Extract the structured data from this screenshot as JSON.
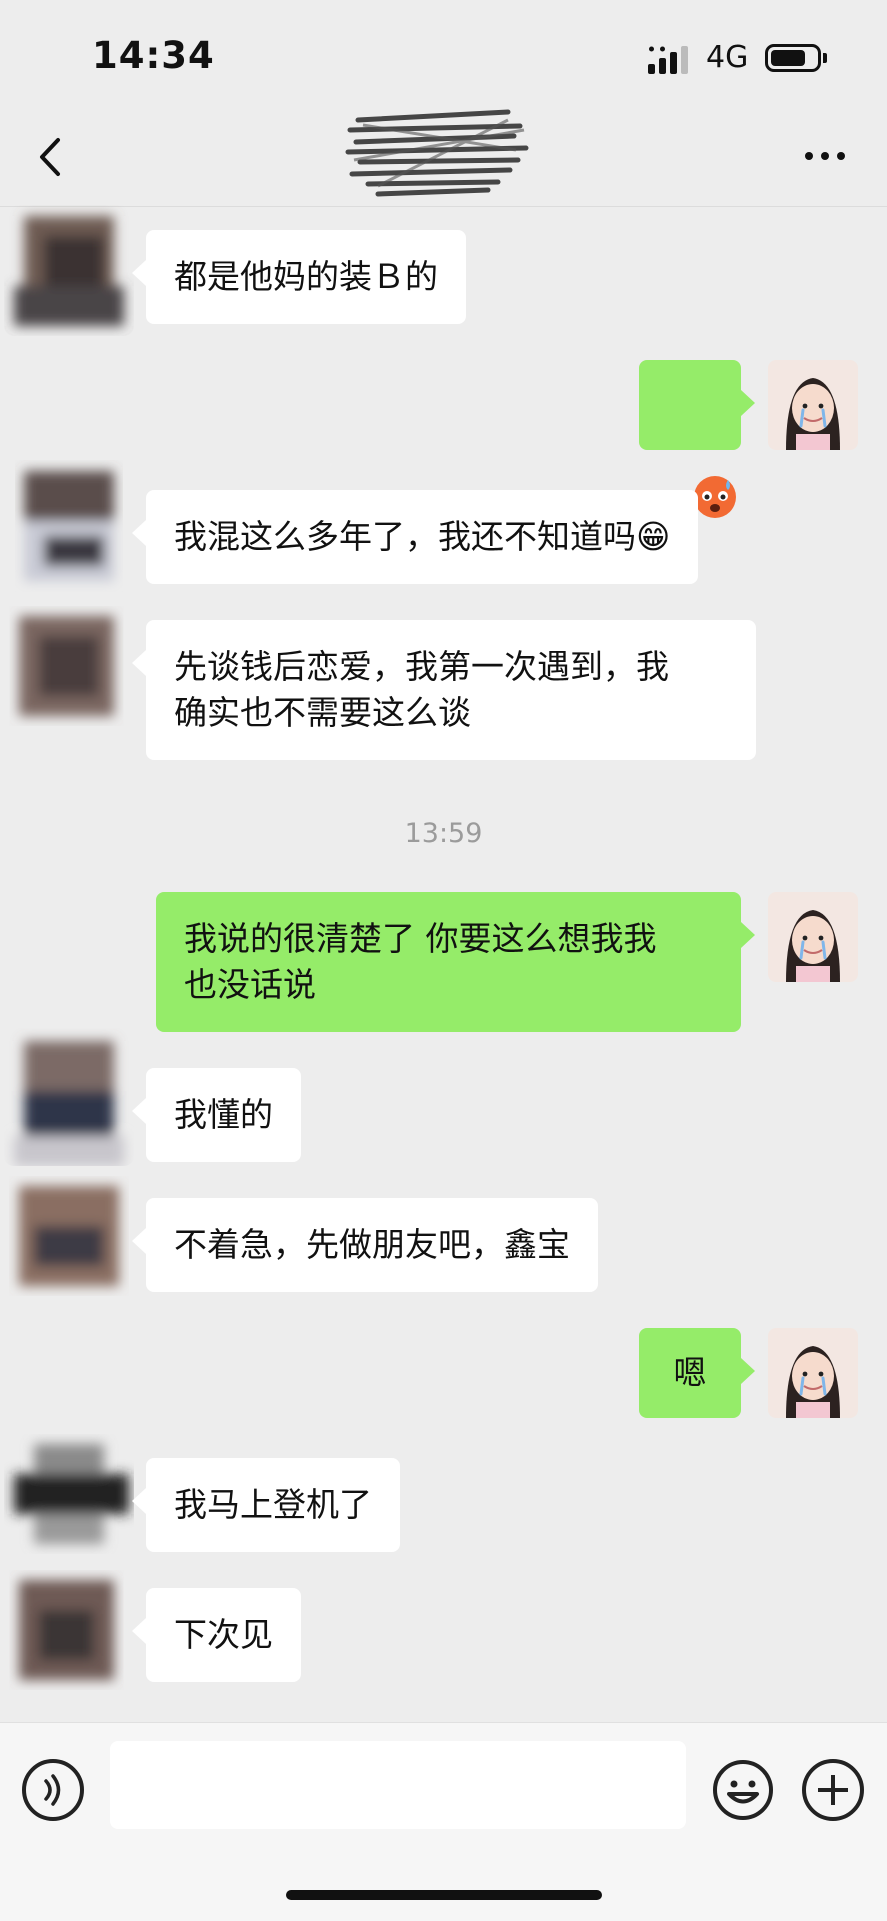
{
  "status_bar": {
    "time": "14:34",
    "network": "4G"
  },
  "nav": {
    "title": "",
    "back_icon": "chevron-left-icon",
    "more_icon": "more-dots-icon"
  },
  "messages": [
    {
      "side": "in",
      "text": "都是他妈的装Ｂ的"
    },
    {
      "side": "out",
      "emoji": "😨"
    },
    {
      "side": "in",
      "text": "我混这么多年了，我还不知道吗😁"
    },
    {
      "side": "in",
      "text": "先谈钱后恋爱，我第一次遇到，我\n确实也不需要这么谈"
    },
    {
      "side": "out",
      "text": "我说的很清楚了 你要这么想我我\n也没话说"
    },
    {
      "side": "in",
      "text": "我懂的"
    },
    {
      "side": "in",
      "text": "不着急，先做朋友吧，鑫宝"
    },
    {
      "side": "out",
      "text": "嗯"
    },
    {
      "side": "in",
      "text": "我马上登机了"
    },
    {
      "side": "in",
      "text": "下次见"
    }
  ],
  "timestamp": "13:59",
  "input": {
    "value": "",
    "placeholder": ""
  },
  "colors": {
    "background": "#ededed",
    "outgoing_bubble": "#95ec69",
    "incoming_bubble": "#ffffff",
    "timestamp": "#9b9b9b"
  }
}
